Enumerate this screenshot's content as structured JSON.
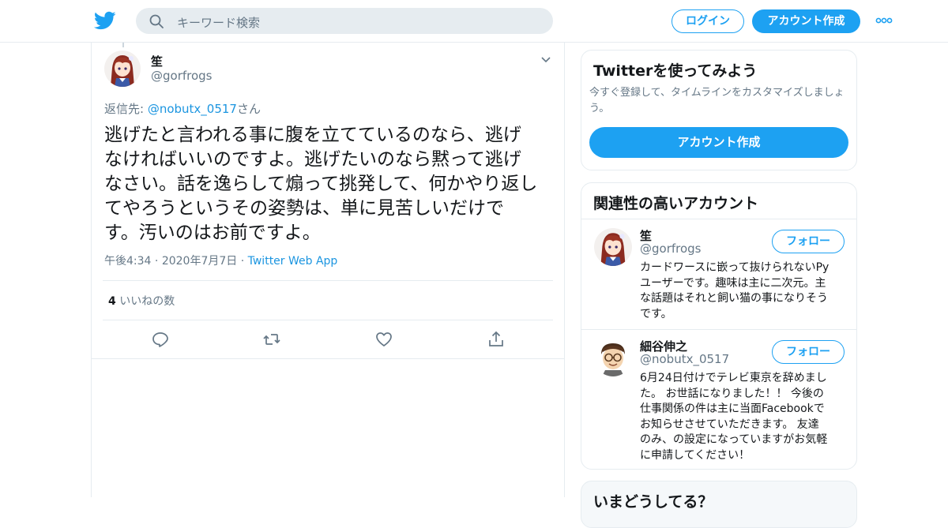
{
  "header": {
    "logo": "twitter-bird-icon",
    "search_placeholder": "キーワード検索",
    "login_label": "ログイン",
    "signup_label": "アカウント作成",
    "more_icon": "more-dots-icon",
    "accent": "#1da1f2"
  },
  "tweet": {
    "author_name": "笙",
    "author_handle": "@gorfrogs",
    "reply_prefix": "返信先: ",
    "reply_handle": "@nobutx_0517",
    "reply_suffix": "さん",
    "text_lines": [
      "逃げたと言われる事に腹を立てているのなら、逃げ",
      "なければいいのですよ。逃げたいのなら黙って逃げ",
      "なさい。話を逸らして煽って挑発して、何かやり返し",
      "てやろうというその姿勢は、単に見苦しいだけで",
      "す。汚いのはお前ですよ。"
    ],
    "time": "午後4:34",
    "date": "2020年7月7日",
    "sep": "·",
    "app": "Twitter Web App",
    "likes_count": "4",
    "likes_label": "いいねの数"
  },
  "sidebar": {
    "try_card": {
      "title": "Twitterを使ってみよう",
      "subtitle": "今すぐ登録して、タイムラインをカスタマイズしましょう。",
      "cta": "アカウント作成"
    },
    "related": {
      "title": "関連性の高いアカウント",
      "accounts": [
        {
          "name": "笙",
          "handle": "@gorfrogs",
          "follow": "フォロー",
          "bio_lines": [
            "カードワースに嵌って抜けられないPy",
            "ユーザーです。趣味は主に二次元。主",
            "な話題はそれと飼い猫の事になりそう",
            "です。"
          ]
        },
        {
          "name": "細谷伸之",
          "handle": "@nobutx_0517",
          "follow": "フォロー",
          "bio_lines": [
            "6月24日付けでテレビ東京を辞めまし",
            "た。 お世話になりました！！ 今後の",
            "仕事関係の件は主に当面Facebookで",
            "お知らせさせていただきます。 友達",
            "のみ、の設定になっていますがお気軽",
            "に申請してください！"
          ]
        }
      ]
    },
    "trends": {
      "title": "いまどうしてる？"
    }
  }
}
